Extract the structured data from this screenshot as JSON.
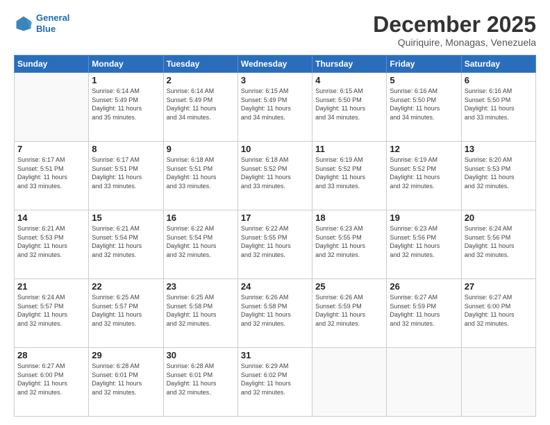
{
  "header": {
    "logo_line1": "General",
    "logo_line2": "Blue",
    "month_title": "December 2025",
    "location": "Quiriquire, Monagas, Venezuela"
  },
  "weekdays": [
    "Sunday",
    "Monday",
    "Tuesday",
    "Wednesday",
    "Thursday",
    "Friday",
    "Saturday"
  ],
  "weeks": [
    [
      {
        "day": "",
        "info": ""
      },
      {
        "day": "1",
        "info": "Sunrise: 6:14 AM\nSunset: 5:49 PM\nDaylight: 11 hours\nand 35 minutes."
      },
      {
        "day": "2",
        "info": "Sunrise: 6:14 AM\nSunset: 5:49 PM\nDaylight: 11 hours\nand 34 minutes."
      },
      {
        "day": "3",
        "info": "Sunrise: 6:15 AM\nSunset: 5:49 PM\nDaylight: 11 hours\nand 34 minutes."
      },
      {
        "day": "4",
        "info": "Sunrise: 6:15 AM\nSunset: 5:50 PM\nDaylight: 11 hours\nand 34 minutes."
      },
      {
        "day": "5",
        "info": "Sunrise: 6:16 AM\nSunset: 5:50 PM\nDaylight: 11 hours\nand 34 minutes."
      },
      {
        "day": "6",
        "info": "Sunrise: 6:16 AM\nSunset: 5:50 PM\nDaylight: 11 hours\nand 33 minutes."
      }
    ],
    [
      {
        "day": "7",
        "info": "Sunrise: 6:17 AM\nSunset: 5:51 PM\nDaylight: 11 hours\nand 33 minutes."
      },
      {
        "day": "8",
        "info": "Sunrise: 6:17 AM\nSunset: 5:51 PM\nDaylight: 11 hours\nand 33 minutes."
      },
      {
        "day": "9",
        "info": "Sunrise: 6:18 AM\nSunset: 5:51 PM\nDaylight: 11 hours\nand 33 minutes."
      },
      {
        "day": "10",
        "info": "Sunrise: 6:18 AM\nSunset: 5:52 PM\nDaylight: 11 hours\nand 33 minutes."
      },
      {
        "day": "11",
        "info": "Sunrise: 6:19 AM\nSunset: 5:52 PM\nDaylight: 11 hours\nand 33 minutes."
      },
      {
        "day": "12",
        "info": "Sunrise: 6:19 AM\nSunset: 5:52 PM\nDaylight: 11 hours\nand 32 minutes."
      },
      {
        "day": "13",
        "info": "Sunrise: 6:20 AM\nSunset: 5:53 PM\nDaylight: 11 hours\nand 32 minutes."
      }
    ],
    [
      {
        "day": "14",
        "info": "Sunrise: 6:21 AM\nSunset: 5:53 PM\nDaylight: 11 hours\nand 32 minutes."
      },
      {
        "day": "15",
        "info": "Sunrise: 6:21 AM\nSunset: 5:54 PM\nDaylight: 11 hours\nand 32 minutes."
      },
      {
        "day": "16",
        "info": "Sunrise: 6:22 AM\nSunset: 5:54 PM\nDaylight: 11 hours\nand 32 minutes."
      },
      {
        "day": "17",
        "info": "Sunrise: 6:22 AM\nSunset: 5:55 PM\nDaylight: 11 hours\nand 32 minutes."
      },
      {
        "day": "18",
        "info": "Sunrise: 6:23 AM\nSunset: 5:55 PM\nDaylight: 11 hours\nand 32 minutes."
      },
      {
        "day": "19",
        "info": "Sunrise: 6:23 AM\nSunset: 5:56 PM\nDaylight: 11 hours\nand 32 minutes."
      },
      {
        "day": "20",
        "info": "Sunrise: 6:24 AM\nSunset: 5:56 PM\nDaylight: 11 hours\nand 32 minutes."
      }
    ],
    [
      {
        "day": "21",
        "info": "Sunrise: 6:24 AM\nSunset: 5:57 PM\nDaylight: 11 hours\nand 32 minutes."
      },
      {
        "day": "22",
        "info": "Sunrise: 6:25 AM\nSunset: 5:57 PM\nDaylight: 11 hours\nand 32 minutes."
      },
      {
        "day": "23",
        "info": "Sunrise: 6:25 AM\nSunset: 5:58 PM\nDaylight: 11 hours\nand 32 minutes."
      },
      {
        "day": "24",
        "info": "Sunrise: 6:26 AM\nSunset: 5:58 PM\nDaylight: 11 hours\nand 32 minutes."
      },
      {
        "day": "25",
        "info": "Sunrise: 6:26 AM\nSunset: 5:59 PM\nDaylight: 11 hours\nand 32 minutes."
      },
      {
        "day": "26",
        "info": "Sunrise: 6:27 AM\nSunset: 5:59 PM\nDaylight: 11 hours\nand 32 minutes."
      },
      {
        "day": "27",
        "info": "Sunrise: 6:27 AM\nSunset: 6:00 PM\nDaylight: 11 hours\nand 32 minutes."
      }
    ],
    [
      {
        "day": "28",
        "info": "Sunrise: 6:27 AM\nSunset: 6:00 PM\nDaylight: 11 hours\nand 32 minutes."
      },
      {
        "day": "29",
        "info": "Sunrise: 6:28 AM\nSunset: 6:01 PM\nDaylight: 11 hours\nand 32 minutes."
      },
      {
        "day": "30",
        "info": "Sunrise: 6:28 AM\nSunset: 6:01 PM\nDaylight: 11 hours\nand 32 minutes."
      },
      {
        "day": "31",
        "info": "Sunrise: 6:29 AM\nSunset: 6:02 PM\nDaylight: 11 hours\nand 32 minutes."
      },
      {
        "day": "",
        "info": ""
      },
      {
        "day": "",
        "info": ""
      },
      {
        "day": "",
        "info": ""
      }
    ]
  ]
}
